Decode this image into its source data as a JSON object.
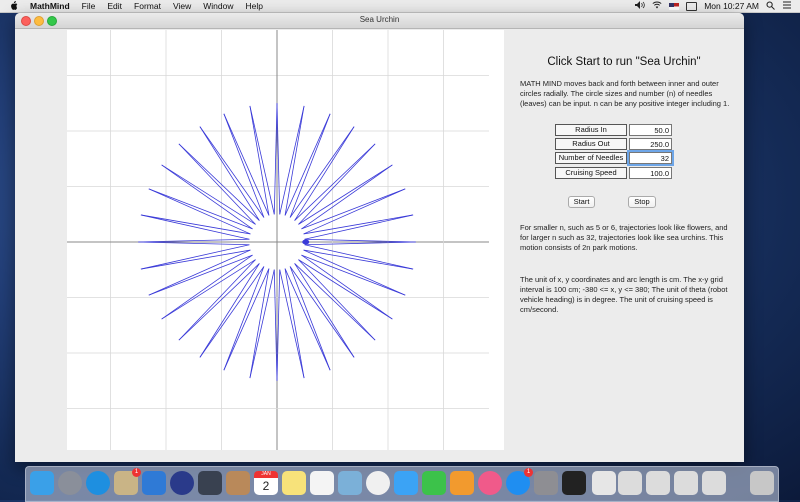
{
  "menubar": {
    "app_name": "MathMind",
    "items": [
      "File",
      "Edit",
      "Format",
      "View",
      "Window",
      "Help"
    ],
    "clock": "Mon 10:27 AM",
    "icons": [
      "apple-icon",
      "volume-icon",
      "wifi-icon",
      "flag-icon",
      "battery-icon",
      "search-icon",
      "control-center-icon"
    ]
  },
  "window": {
    "title": "Sea Urchin"
  },
  "panel": {
    "heading": "Click Start to run \"Sea Urchin\"",
    "desc1": "MATH MIND moves back and forth between inner and outer circles radially.  The circle sizes and number (n) of needles (leaves) can be input. n can be any positive integer including 1.",
    "params": [
      {
        "label": "Radius In",
        "value": "50.0"
      },
      {
        "label": "Radius Out",
        "value": "250.0"
      },
      {
        "label": "Number of Needles",
        "value": "32"
      },
      {
        "label": "Cruising Speed",
        "value": "100.0"
      }
    ],
    "start_label": "Start",
    "stop_label": "Stop",
    "desc2": "For smaller n, such as 5 or 6, trajectories look like flowers, and for larger n such as 32, trajectories look like sea urchins. This motion consists of 2n park motions.",
    "desc3": "The unit of x, y coordinates and arc length is cm.  The x-y grid interval is 100 cm; -380 <= x, y <= 380; The unit of theta (robot vehicle heading) is in degree. The unit of cruising speed is cm/second."
  },
  "plot": {
    "grid_spacing_cm": 100,
    "radius_in": 50,
    "radius_out": 250,
    "needles": 32,
    "line_color": "#3a3ad8",
    "grid_color": "#d9d9d9",
    "axis_color": "#888888"
  },
  "dock": {
    "icons": [
      {
        "name": "finder-icon",
        "badge": ""
      },
      {
        "name": "launchpad-icon",
        "badge": ""
      },
      {
        "name": "safari-icon",
        "badge": ""
      },
      {
        "name": "photo-app-icon",
        "badge": "1"
      },
      {
        "name": "xcode-icon",
        "badge": ""
      },
      {
        "name": "network-utility-icon",
        "badge": ""
      },
      {
        "name": "feather-pen-icon",
        "badge": ""
      },
      {
        "name": "contacts-icon",
        "badge": ""
      },
      {
        "name": "calendar-icon",
        "badge": "",
        "month": "JAN",
        "day": "2"
      },
      {
        "name": "notes-icon",
        "badge": ""
      },
      {
        "name": "reminders-icon",
        "badge": ""
      },
      {
        "name": "preview-icon",
        "badge": ""
      },
      {
        "name": "photos-icon",
        "badge": ""
      },
      {
        "name": "messages-icon",
        "badge": ""
      },
      {
        "name": "facetime-icon",
        "badge": ""
      },
      {
        "name": "ibooks-icon",
        "badge": ""
      },
      {
        "name": "itunes-icon",
        "badge": ""
      },
      {
        "name": "app-store-icon",
        "badge": "1"
      },
      {
        "name": "system-preferences-icon",
        "badge": ""
      },
      {
        "name": "terminal-icon",
        "badge": ""
      },
      {
        "name": "document-icon",
        "badge": ""
      },
      {
        "name": "window-thumb-icon",
        "badge": ""
      },
      {
        "name": "window-thumb-icon",
        "badge": ""
      },
      {
        "name": "window-thumb-icon",
        "badge": ""
      },
      {
        "name": "window-thumb-icon",
        "badge": ""
      },
      {
        "name": "trash-icon",
        "badge": ""
      }
    ]
  }
}
